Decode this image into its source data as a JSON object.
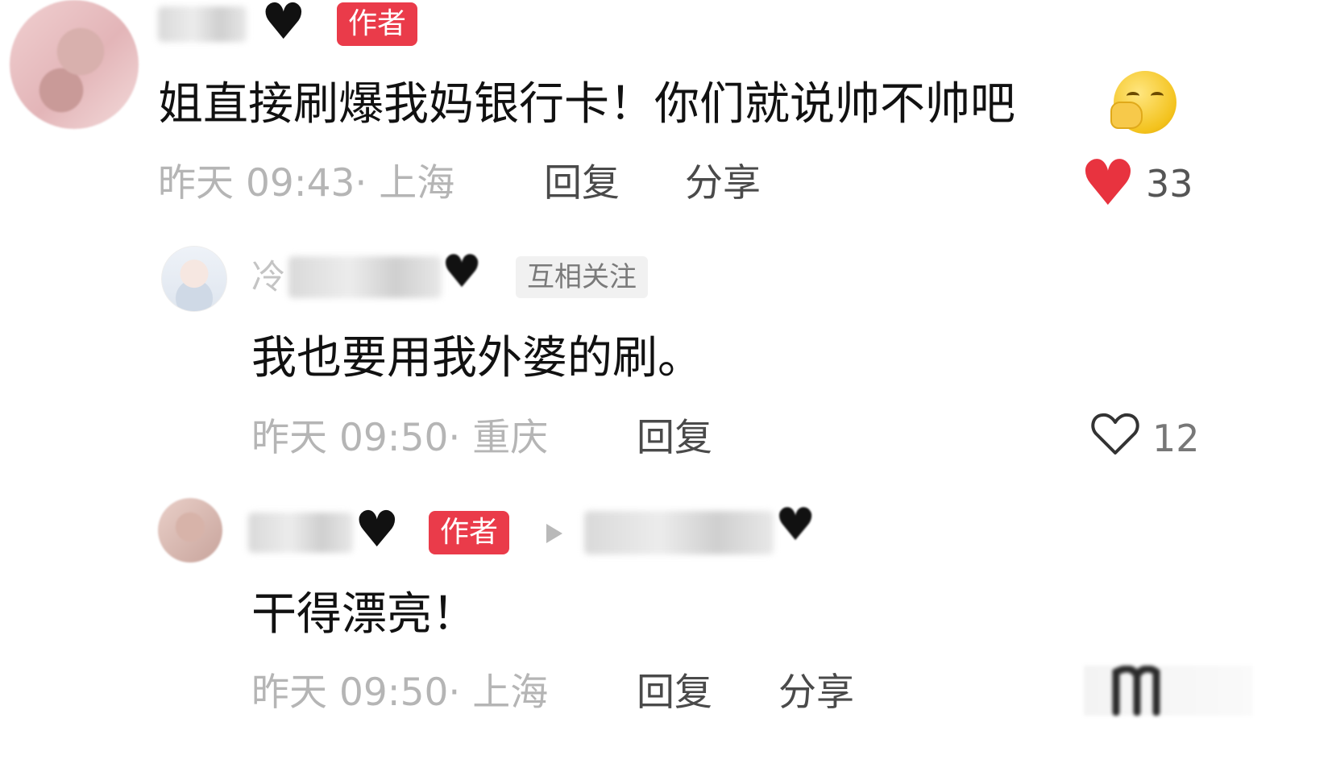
{
  "comments": [
    {
      "badge": "作者",
      "text": "姐直接刷爆我妈银行卡！你们就说帅不帅吧",
      "emoji": "covering-mouth-emoji",
      "meta": "昨天 09:43· 上海",
      "reply_label": "回复",
      "share_label": "分享",
      "likes": "33",
      "liked": true
    },
    {
      "username_visible": "冷",
      "badge": "互相关注",
      "text": "我也要用我外婆的刷。",
      "meta": "昨天 09:50· 重庆",
      "reply_label": "回复",
      "likes": "12",
      "liked": false
    },
    {
      "badge": "作者",
      "text": "干得漂亮！",
      "meta": "昨天 09:50· 上海",
      "reply_label": "回复",
      "share_label": "分享"
    }
  ],
  "colors": {
    "author_badge": "#ea3b4a",
    "liked_heart": "#e8333f",
    "meta_text": "#b5b5b5"
  }
}
